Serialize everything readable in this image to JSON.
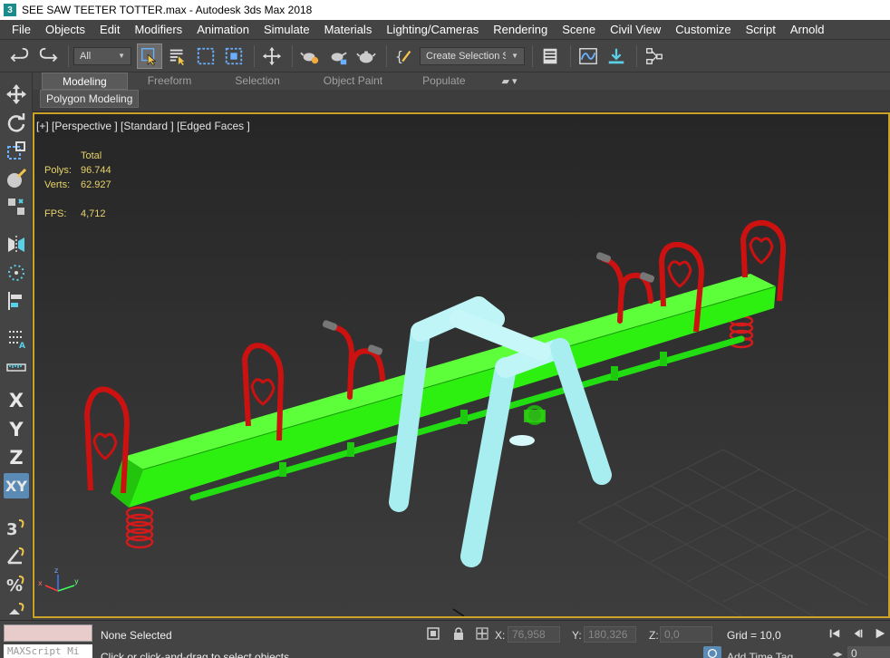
{
  "window": {
    "app_icon": "3",
    "title": "SEE SAW TEETER TOTTER.max - Autodesk 3ds Max 2018"
  },
  "menu": [
    "File",
    "Objects",
    "Edit",
    "Modifiers",
    "Animation",
    "Simulate",
    "Materials",
    "Lighting/Cameras",
    "Rendering",
    "Scene",
    "Civil View",
    "Customize",
    "Script",
    "Arnold"
  ],
  "toolbar": {
    "filter_value": "All",
    "selection_set_value": "Create Selection Se"
  },
  "ribbon": {
    "tabs": [
      "Modeling",
      "Freeform",
      "Selection",
      "Object Paint",
      "Populate"
    ],
    "active_tab": "Modeling",
    "panel_label": "Polygon Modeling"
  },
  "leftbar": {
    "axis_x": "X",
    "axis_y": "Y",
    "axis_z": "Z",
    "axis_xy": "XY"
  },
  "viewport": {
    "label": "[+] [Perspective ] [Standard ] [Edged Faces ]",
    "stats_header": "Total",
    "polys_label": "Polys:",
    "polys_value": "96.744",
    "verts_label": "Verts:",
    "verts_value": "62.927",
    "fps_label": "FPS:",
    "fps_value": "4,712",
    "colors": {
      "plank": "#33ff11",
      "handles": "#dd1111",
      "frame": "#aaeef0",
      "border": "#c9a227"
    }
  },
  "status": {
    "selection": "None Selected",
    "prompt": "Click or click-and-drag to select objects",
    "maxscript_placeholder": "MAXScript Mi",
    "x_label": "X:",
    "x_value": "76,958",
    "y_label": "Y:",
    "y_value": "180,326",
    "z_label": "Z:",
    "z_value": "0,0",
    "grid": "Grid = 10,0",
    "add_time_tag": "Add Time Tag",
    "frame": "0"
  }
}
